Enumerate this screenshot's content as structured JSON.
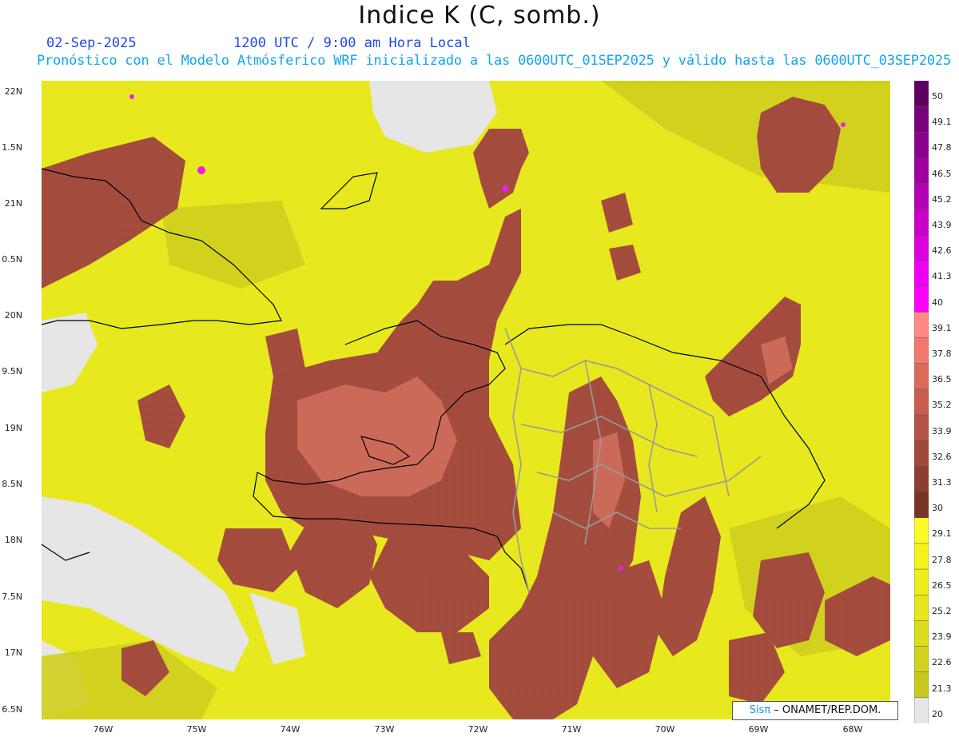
{
  "header": {
    "title": "Indice K (C, somb.)",
    "date": "02-Sep-2025",
    "time": "1200 UTC / 9:00 am Hora Local",
    "forecast": "Pronóstico con el Modelo Atmósferico WRF inicializado a las 0600UTC_01SEP2025 y válido hasta las  0600UTC_03SEP2025"
  },
  "map": {
    "lat_labels": [
      "22N",
      "1.5N",
      "21N",
      "0.5N",
      "20N",
      "9.5N",
      "19N",
      "8.5N",
      "18N",
      "7.5N",
      "17N",
      "6.5N"
    ],
    "lon_labels": [
      "76W",
      "75W",
      "74W",
      "73W",
      "72W",
      "71W",
      "70W",
      "69W",
      "68W"
    ],
    "colors": {
      "background_low": "#c8c81e",
      "mid_yellow": "#f4f41c",
      "high_brown": "#a04a3c",
      "land_gray": "#e6e6e6",
      "coast_line": "#000000",
      "province_line": "#9a9a9a"
    }
  },
  "colorbar": {
    "labels": [
      "50",
      "49.1",
      "47.8",
      "46.5",
      "45.2",
      "43.9",
      "42.6",
      "41.3",
      "40",
      "39.1",
      "37.8",
      "36.5",
      "35.2",
      "33.9",
      "32.6",
      "31.3",
      "30",
      "29.1",
      "27.8",
      "26.5",
      "25.2",
      "23.9",
      "22.6",
      "21.3",
      "20"
    ],
    "colors": [
      "#5e0060",
      "#780078",
      "#8c008c",
      "#a000a0",
      "#b400b4",
      "#c800c8",
      "#dc00dc",
      "#f000f0",
      "#ff00ff",
      "#ff8a84",
      "#f0786e",
      "#dc6a5c",
      "#c85e50",
      "#b45444",
      "#a0483a",
      "#8c3e30",
      "#7a3426",
      "#fafa28",
      "#f4f41c",
      "#eeee1c",
      "#e6e61c",
      "#dcdc1e",
      "#d2d21e",
      "#c8c81e",
      "#e6e6e6"
    ]
  },
  "credit": {
    "brand": "Sisπ",
    "text": " – ONAMET/REP.DOM."
  }
}
